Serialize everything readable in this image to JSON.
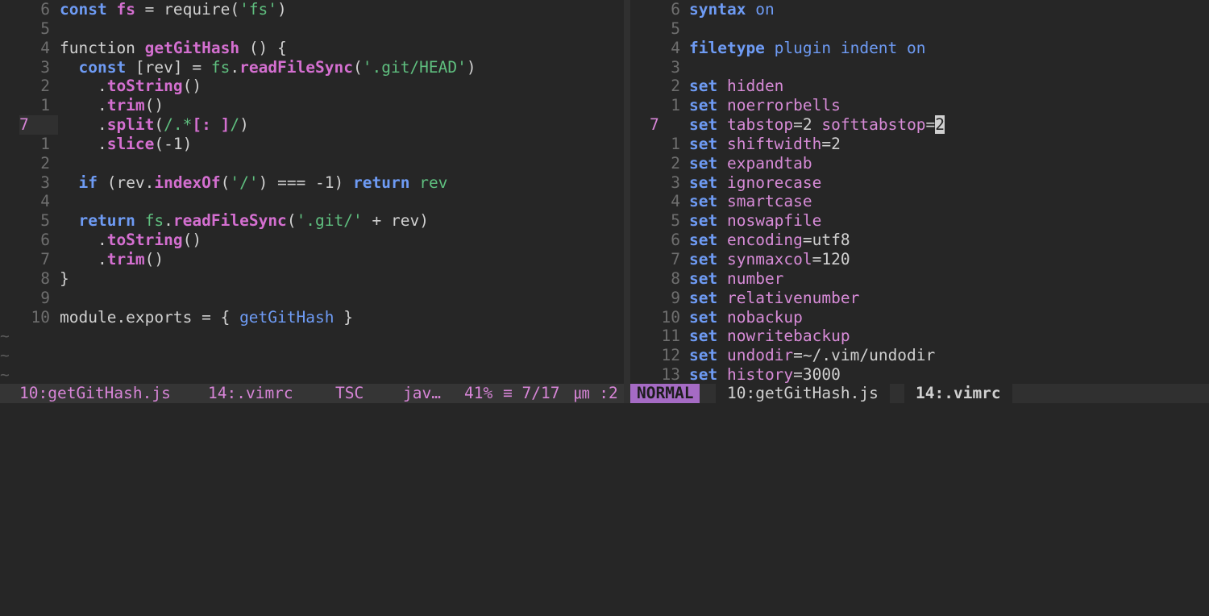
{
  "left_pane": {
    "lines": [
      {
        "num": "6",
        "tokens": [
          [
            "k",
            "const"
          ],
          [
            "p",
            " "
          ],
          [
            "fn",
            "fs"
          ],
          [
            "p",
            " = require("
          ],
          [
            "s",
            "'fs'"
          ],
          [
            "p",
            ")"
          ]
        ]
      },
      {
        "num": "5",
        "tokens": []
      },
      {
        "num": "4",
        "tokens": [
          [
            "p",
            "function "
          ],
          [
            "fn",
            "getGitHash"
          ],
          [
            "p",
            " () {"
          ]
        ]
      },
      {
        "num": "3",
        "tokens": [
          [
            "p",
            "  "
          ],
          [
            "k",
            "const"
          ],
          [
            "p",
            " [rev] = "
          ],
          [
            "s",
            "fs"
          ],
          [
            "p",
            "."
          ],
          [
            "fn",
            "readFileSync"
          ],
          [
            "p",
            "("
          ],
          [
            "s",
            "'.git/HEAD'"
          ],
          [
            "p",
            ")"
          ]
        ]
      },
      {
        "num": "2",
        "tokens": [
          [
            "p",
            "    ."
          ],
          [
            "fn",
            "toString"
          ],
          [
            "p",
            "()"
          ]
        ]
      },
      {
        "num": "1",
        "tokens": [
          [
            "p",
            "    ."
          ],
          [
            "fn",
            "trim"
          ],
          [
            "p",
            "()"
          ]
        ]
      },
      {
        "num": "7",
        "current": true,
        "tokens": [
          [
            "p",
            "    ."
          ],
          [
            "fn",
            "split"
          ],
          [
            "p",
            "("
          ],
          [
            "s",
            "/.*"
          ],
          [
            "fn",
            "[: ]"
          ],
          [
            "s",
            "/"
          ],
          [
            "p",
            ")"
          ]
        ]
      },
      {
        "num": "1",
        "tokens": [
          [
            "p",
            "    ."
          ],
          [
            "fn",
            "slice"
          ],
          [
            "p",
            "(-1)"
          ]
        ]
      },
      {
        "num": "2",
        "tokens": []
      },
      {
        "num": "3",
        "tokens": [
          [
            "p",
            "  "
          ],
          [
            "k",
            "if"
          ],
          [
            "p",
            " (rev."
          ],
          [
            "fn",
            "indexOf"
          ],
          [
            "p",
            "("
          ],
          [
            "s",
            "'/'"
          ],
          [
            "p",
            ") === -1) "
          ],
          [
            "k",
            "return"
          ],
          [
            "p",
            " "
          ],
          [
            "s",
            "rev"
          ]
        ]
      },
      {
        "num": "4",
        "tokens": []
      },
      {
        "num": "5",
        "tokens": [
          [
            "p",
            "  "
          ],
          [
            "k",
            "return"
          ],
          [
            "p",
            " "
          ],
          [
            "s",
            "fs"
          ],
          [
            "p",
            "."
          ],
          [
            "fn",
            "readFileSync"
          ],
          [
            "p",
            "("
          ],
          [
            "s",
            "'.git/'"
          ],
          [
            "p",
            " + rev)"
          ]
        ]
      },
      {
        "num": "6",
        "tokens": [
          [
            "p",
            "    ."
          ],
          [
            "fn",
            "toString"
          ],
          [
            "p",
            "()"
          ]
        ]
      },
      {
        "num": "7",
        "tokens": [
          [
            "p",
            "    ."
          ],
          [
            "fn",
            "trim"
          ],
          [
            "p",
            "()"
          ]
        ]
      },
      {
        "num": "8",
        "tokens": [
          [
            "p",
            "}"
          ]
        ]
      },
      {
        "num": "9",
        "tokens": []
      },
      {
        "num": "10",
        "tokens": [
          [
            "p",
            "module.exports = { "
          ],
          [
            "kn",
            "getGitHash"
          ],
          [
            "p",
            " }"
          ]
        ]
      }
    ],
    "empty_markers": [
      "~",
      "~",
      "~"
    ]
  },
  "right_pane": {
    "lines": [
      {
        "num": "6",
        "tokens": [
          [
            "set",
            "syntax"
          ],
          [
            "p",
            " "
          ],
          [
            "kn",
            "on"
          ]
        ]
      },
      {
        "num": "5",
        "tokens": []
      },
      {
        "num": "4",
        "tokens": [
          [
            "set",
            "filetype"
          ],
          [
            "p",
            " "
          ],
          [
            "kn",
            "plugin indent on"
          ]
        ]
      },
      {
        "num": "3",
        "tokens": []
      },
      {
        "num": "2",
        "tokens": [
          [
            "set",
            "set"
          ],
          [
            "p",
            " "
          ],
          [
            "opt",
            "hidden"
          ]
        ]
      },
      {
        "num": "1",
        "tokens": [
          [
            "set",
            "set"
          ],
          [
            "p",
            " "
          ],
          [
            "opt",
            "noerrorbells"
          ]
        ]
      },
      {
        "num": "7",
        "current": true,
        "tokens": [
          [
            "set",
            "set"
          ],
          [
            "p",
            " "
          ],
          [
            "opt",
            "tabstop"
          ],
          [
            "p",
            "=2 "
          ],
          [
            "opt",
            "softtabstop"
          ],
          [
            "p",
            "="
          ],
          [
            "cursor",
            "2"
          ]
        ]
      },
      {
        "num": "1",
        "tokens": [
          [
            "set",
            "set"
          ],
          [
            "p",
            " "
          ],
          [
            "opt",
            "shiftwidth"
          ],
          [
            "p",
            "=2"
          ]
        ]
      },
      {
        "num": "2",
        "tokens": [
          [
            "set",
            "set"
          ],
          [
            "p",
            " "
          ],
          [
            "opt",
            "expandtab"
          ]
        ]
      },
      {
        "num": "3",
        "tokens": [
          [
            "set",
            "set"
          ],
          [
            "p",
            " "
          ],
          [
            "opt",
            "ignorecase"
          ]
        ]
      },
      {
        "num": "4",
        "tokens": [
          [
            "set",
            "set"
          ],
          [
            "p",
            " "
          ],
          [
            "opt",
            "smartcase"
          ]
        ]
      },
      {
        "num": "5",
        "tokens": [
          [
            "set",
            "set"
          ],
          [
            "p",
            " "
          ],
          [
            "opt",
            "noswapfile"
          ]
        ]
      },
      {
        "num": "6",
        "tokens": [
          [
            "set",
            "set"
          ],
          [
            "p",
            " "
          ],
          [
            "opt",
            "encoding"
          ],
          [
            "p",
            "=utf8"
          ]
        ]
      },
      {
        "num": "7",
        "tokens": [
          [
            "set",
            "set"
          ],
          [
            "p",
            " "
          ],
          [
            "opt",
            "synmaxcol"
          ],
          [
            "p",
            "=120"
          ]
        ]
      },
      {
        "num": "8",
        "tokens": [
          [
            "set",
            "set"
          ],
          [
            "p",
            " "
          ],
          [
            "opt",
            "number"
          ]
        ]
      },
      {
        "num": "9",
        "tokens": [
          [
            "set",
            "set"
          ],
          [
            "p",
            " "
          ],
          [
            "opt",
            "relativenumber"
          ]
        ]
      },
      {
        "num": "10",
        "tokens": [
          [
            "set",
            "set"
          ],
          [
            "p",
            " "
          ],
          [
            "opt",
            "nobackup"
          ]
        ]
      },
      {
        "num": "11",
        "tokens": [
          [
            "set",
            "set"
          ],
          [
            "p",
            " "
          ],
          [
            "opt",
            "nowritebackup"
          ]
        ]
      },
      {
        "num": "12",
        "tokens": [
          [
            "set",
            "set"
          ],
          [
            "p",
            " "
          ],
          [
            "opt",
            "undodir"
          ],
          [
            "p",
            "=~/.vim/undodir"
          ]
        ]
      },
      {
        "num": "13",
        "tokens": [
          [
            "set",
            "set"
          ],
          [
            "p",
            " "
          ],
          [
            "opt",
            "history"
          ],
          [
            "p",
            "=3000"
          ]
        ]
      }
    ]
  },
  "statusbar": {
    "left_file": "10:getGitHash.js",
    "left_other": "14:.vimrc",
    "tsc": "TSC",
    "filetype": "jav…",
    "percent": "41%",
    "position": "≡ 7/17",
    "col": "㎛ :2",
    "mode": "NORMAL",
    "right_file": "10:getGitHash.js",
    "right_active": "14:.vimrc"
  }
}
